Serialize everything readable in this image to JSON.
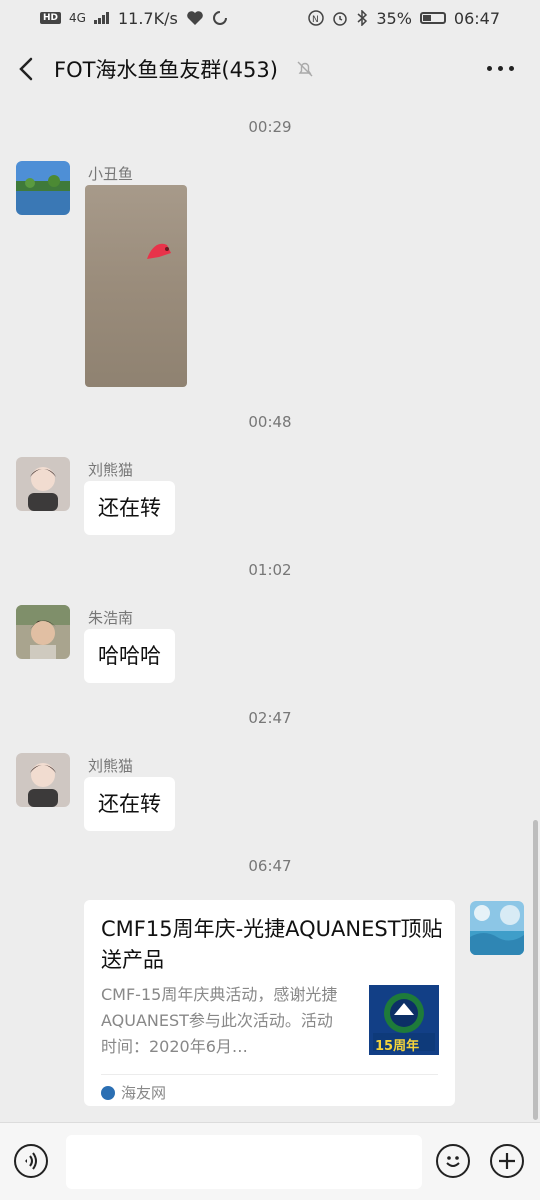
{
  "status_bar": {
    "hd": "HD",
    "net_type": "4G",
    "speed": "11.7K/s",
    "battery_pct": "35%",
    "battery_level": 0.35,
    "time": "06:47"
  },
  "header": {
    "title": "FOT海水鱼鱼友群(453)"
  },
  "messages": [
    {
      "timestamp": "00:29",
      "sender": "小丑鱼",
      "type": "video"
    },
    {
      "timestamp": "00:48",
      "sender": "刘熊猫",
      "text": "还在转"
    },
    {
      "timestamp": "01:02",
      "sender": "朱浩南",
      "text": "哈哈哈"
    },
    {
      "timestamp": "02:47",
      "sender": "刘熊猫",
      "text": "还在转"
    },
    {
      "timestamp": "06:47",
      "type": "link_card",
      "title": "CMF15周年庆-光捷AQUANEST顶贴送产品",
      "desc": "CMF-15周年庆典活动，感谢光捷AQUANEST参与此次活动。活动时间：2020年6月…",
      "thumb_text": "15周年",
      "source": "海友网"
    }
  ],
  "icons": {
    "back": "chevron-left-icon",
    "mute": "bell-off-icon",
    "more": "more-icon",
    "voice": "voice-icon",
    "emoji": "emoji-icon",
    "plus": "plus-icon"
  },
  "colors": {
    "background": "#ededed",
    "bubble": "#ffffff",
    "bottom_bar": "#f6f6f6"
  }
}
